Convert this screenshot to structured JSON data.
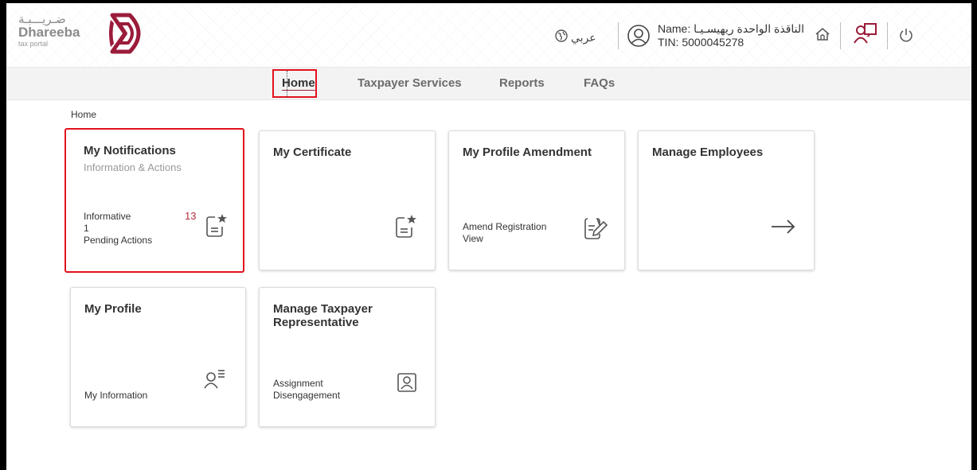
{
  "brand": {
    "arabic": "ضـريـــبـة",
    "name": "Dhareeba",
    "tagline": "tax portal"
  },
  "header": {
    "language_link": "عربي",
    "user_name": "Name: الناقذة الواحدة ريهيسـيـا",
    "tin": "TIN: 5000045278"
  },
  "nav": {
    "items": [
      {
        "label": "Home",
        "active": true
      },
      {
        "label": "Taxpayer Services"
      },
      {
        "label": "Reports"
      },
      {
        "label": "FAQs"
      }
    ]
  },
  "breadcrumb": "Home",
  "cards": {
    "notifications": {
      "title": "My Notifications",
      "subtitle": "Information & Actions",
      "informative_label": "Informative",
      "informative_count": "13",
      "pending_count": "1",
      "pending_label": "Pending Actions"
    },
    "certificate": {
      "title": "My Certificate"
    },
    "profile_amendment": {
      "title": "My Profile Amendment",
      "line1": "Amend Registration",
      "line2": "View"
    },
    "manage_employees": {
      "title": "Manage Employees"
    },
    "my_profile": {
      "title": "My Profile",
      "line1": "My Information"
    },
    "representative": {
      "title_line1": "Manage Taxpayer",
      "title_line2": "Representative",
      "line1": "Assignment",
      "line2": "Disengagement"
    }
  },
  "colors": {
    "accent": "#9b1c3a",
    "highlight": "#e3121d",
    "count": "#b0323c"
  }
}
